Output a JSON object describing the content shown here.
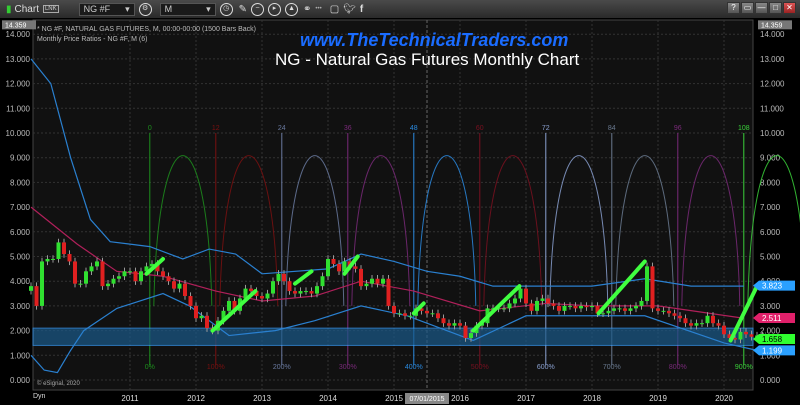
{
  "toolbar": {
    "app_label": "Chart",
    "link_badge": "LNK",
    "symbol": "NG #F",
    "interval": "M",
    "window_buttons": [
      "?",
      "▭",
      "—",
      "□",
      "✕"
    ]
  },
  "chart_info": {
    "line1": "* NG #F, NATURAL GAS FUTURES, M, 00:00-00:00 (1500 Bars Back)",
    "line2": "Monthly Price Ratios - NG #F, M (6)"
  },
  "watermark": "www.TheTechnicalTraders.com",
  "title": "NG - Natural Gas Futures Monthly Chart",
  "copyright": "© eSignal, 2020",
  "dyn_label": "Dyn",
  "chart_data": {
    "type": "candlestick",
    "ylim": [
      0,
      14.359
    ],
    "top_value_label": "14.359",
    "y_ticks": [
      "0.000",
      "1.000",
      "2.000",
      "3.000",
      "4.000",
      "5.000",
      "6.000",
      "7.000",
      "8.000",
      "9.000",
      "10.000",
      "11.000",
      "12.000",
      "13.000",
      "14.000"
    ],
    "x_ticks": [
      "2011",
      "2012",
      "2013",
      "2014",
      "2015",
      "2016",
      "2017",
      "2018",
      "2019",
      "2020"
    ],
    "crosshair_date": "07/01/2015",
    "grid": true,
    "start": "2009-07",
    "close": [
      3.8,
      3.0,
      4.8,
      4.9,
      4.9,
      5.57,
      5.1,
      4.8,
      3.9,
      3.9,
      4.4,
      4.6,
      4.8,
      3.8,
      3.9,
      4.1,
      4.2,
      4.4,
      4.4,
      4.0,
      4.4,
      4.6,
      4.7,
      4.4,
      4.2,
      4.0,
      3.7,
      3.9,
      3.4,
      3.0,
      2.5,
      2.6,
      2.1,
      2.0,
      2.4,
      2.8,
      3.2,
      2.8,
      3.3,
      3.7,
      3.6,
      3.4,
      3.3,
      3.5,
      4.0,
      4.3,
      4.0,
      3.6,
      3.5,
      3.6,
      3.6,
      3.5,
      3.8,
      4.2,
      4.9,
      4.7,
      4.4,
      4.8,
      4.6,
      4.5,
      3.8,
      3.9,
      4.1,
      3.9,
      4.1,
      3.0,
      2.7,
      2.7,
      2.6,
      2.6,
      2.9,
      2.8,
      2.7,
      2.7,
      2.5,
      2.3,
      2.2,
      2.3,
      2.2,
      1.7,
      1.9,
      2.2,
      2.3,
      2.9,
      2.9,
      2.9,
      2.9,
      3.1,
      3.3,
      3.7,
      3.1,
      2.8,
      3.2,
      3.3,
      3.1,
      3.0,
      2.8,
      3.0,
      3.0,
      2.9,
      3.0,
      2.95,
      3.0,
      2.7,
      2.7,
      2.8,
      2.9,
      2.9,
      2.8,
      2.9,
      3.0,
      3.2,
      4.6,
      2.9,
      2.8,
      2.8,
      2.7,
      2.6,
      2.5,
      2.3,
      2.2,
      2.3,
      2.3,
      2.6,
      2.3,
      2.2,
      1.85,
      1.7,
      1.64,
      1.95,
      1.85,
      1.75,
      1.8,
      1.66
    ],
    "upper_band": [
      [
        2009.5,
        13
      ],
      [
        2009.8,
        12
      ],
      [
        2010.1,
        9
      ],
      [
        2010.4,
        6.5
      ],
      [
        2010.7,
        5.6
      ],
      [
        2011.3,
        5.4
      ],
      [
        2011.8,
        4.9
      ],
      [
        2012.2,
        5.3
      ],
      [
        2012.6,
        5.1
      ],
      [
        2013.0,
        4.3
      ],
      [
        2014.0,
        4.5
      ],
      [
        2014.5,
        5.1
      ],
      [
        2015.0,
        4.8
      ],
      [
        2015.5,
        4.4
      ],
      [
        2016.0,
        4.2
      ],
      [
        2016.5,
        3.8
      ],
      [
        2017.5,
        3.8
      ],
      [
        2018.0,
        3.8
      ],
      [
        2018.8,
        4.1
      ],
      [
        2019.5,
        3.8
      ],
      [
        2020.3,
        3.8
      ]
    ],
    "middle_band": [
      [
        2009.5,
        7.0
      ],
      [
        2010.2,
        5.5
      ],
      [
        2010.8,
        4.4
      ],
      [
        2011.5,
        4.2
      ],
      [
        2012.3,
        3.6
      ],
      [
        2013.0,
        3.2
      ],
      [
        2013.8,
        3.4
      ],
      [
        2014.5,
        4.0
      ],
      [
        2015.3,
        3.6
      ],
      [
        2016.3,
        2.8
      ],
      [
        2017.3,
        3.1
      ],
      [
        2018.0,
        3.0
      ],
      [
        2019.0,
        3.0
      ],
      [
        2020.3,
        2.5
      ]
    ],
    "lower_band": [
      [
        2009.5,
        1.0
      ],
      [
        2009.7,
        0.4
      ],
      [
        2009.9,
        0.3
      ],
      [
        2010.1,
        1.2
      ],
      [
        2010.3,
        2.0
      ],
      [
        2010.8,
        2.9
      ],
      [
        2011.5,
        3.5
      ],
      [
        2011.9,
        3.0
      ],
      [
        2012.5,
        1.8
      ],
      [
        2013.2,
        2.0
      ],
      [
        2013.8,
        2.4
      ],
      [
        2014.5,
        3.0
      ],
      [
        2015.2,
        2.6
      ],
      [
        2016.2,
        1.6
      ],
      [
        2017.0,
        2.6
      ],
      [
        2018.0,
        2.6
      ],
      [
        2018.8,
        2.6
      ],
      [
        2020.0,
        1.5
      ],
      [
        2020.5,
        1.2
      ]
    ],
    "support_zone": [
      1.4,
      2.1
    ],
    "highlight_segments": [
      [
        [
          2011.25,
          4.3
        ],
        [
          2011.5,
          4.9
        ]
      ],
      [
        [
          2012.25,
          2.0
        ],
        [
          2012.9,
          3.6
        ]
      ],
      [
        [
          2013.5,
          3.9
        ],
        [
          2013.75,
          4.4
        ]
      ],
      [
        [
          2014.25,
          4.3
        ],
        [
          2014.45,
          5.0
        ]
      ],
      [
        [
          2015.3,
          2.7
        ],
        [
          2015.45,
          3.1
        ]
      ],
      [
        [
          2016.2,
          2.0
        ],
        [
          2016.9,
          3.8
        ]
      ],
      [
        [
          2018.1,
          2.7
        ],
        [
          2018.8,
          4.8
        ]
      ],
      [
        [
          2020.1,
          1.6
        ],
        [
          2020.5,
          3.8
        ]
      ]
    ],
    "cycles": {
      "start": 2011.3,
      "labels": [
        "0",
        "12",
        "24",
        "36",
        "48",
        "60",
        "72",
        "84",
        "96",
        "108"
      ],
      "percent_labels": [
        "0%",
        "100%",
        "200%",
        "300%",
        "400%",
        "500%",
        "600%",
        "700%",
        "800%",
        "900%"
      ],
      "colors": [
        "#1d8f1d",
        "#7a1010",
        "#6a7aa0",
        "#7a2a7a",
        "#2a8ae0",
        "#7a1020",
        "#8aa0d0",
        "#6a7a90",
        "#7a2a7a",
        "#3ad03a"
      ],
      "arc_peak": 9.9
    },
    "price_markers": [
      {
        "value": "3.823",
        "color": "#2aa0ff"
      },
      {
        "value": "2.511",
        "color": "#e0206a"
      },
      {
        "value": "1.658",
        "color": "#30ff30"
      },
      {
        "value": "1.199",
        "color": "#2aa0ff"
      }
    ],
    "colors": {
      "up": "#30e030",
      "down": "#e02020",
      "band": "#2a80d0",
      "middle": "#b0205a",
      "highlight": "#40ff40",
      "zone": "#1a5a8a"
    }
  }
}
